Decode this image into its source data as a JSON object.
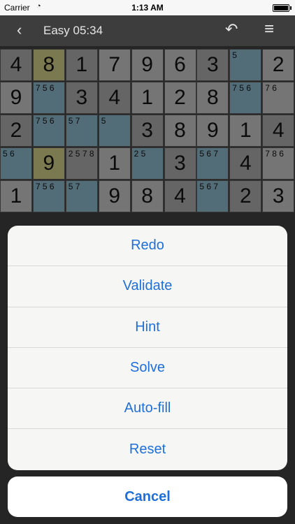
{
  "status_bar": {
    "carrier": "Carrier",
    "time": "1:13 AM"
  },
  "nav": {
    "back_icon": "chevron-left-icon",
    "difficulty": "Easy",
    "timer": "05:34",
    "title": "Easy  05:34"
  },
  "board": {
    "rows": [
      [
        "4",
        "8",
        "1",
        "7",
        "9",
        "6",
        "3",
        "",
        "2"
      ],
      [
        "9",
        "",
        "3",
        "4",
        "1",
        "2",
        "8",
        "",
        ""
      ],
      [
        "2",
        "",
        "",
        "",
        "3",
        "8",
        "9",
        "1",
        "4"
      ],
      [
        "",
        "9",
        "",
        "1",
        "",
        "3",
        "",
        "4",
        ""
      ],
      [
        "1",
        "",
        "",
        "9",
        "8",
        "4",
        "",
        "2",
        "3"
      ]
    ],
    "notes": {
      "r1c8": "5",
      "r2c2": "7 5 6",
      "r2c8": "7 5 6",
      "r2c9": "7 6",
      "r3c2": "7 5 6",
      "r3c3": "5 7",
      "r3c4": "5",
      "r4c1": "5 6",
      "r4c3": "2 5 7 8",
      "r4c5": "2 5",
      "r4c7": "5 6 7",
      "r4c9": "7 8 6",
      "r5c2": "7 5 6",
      "r5c3": "5 7",
      "r5c7": "5 6 7"
    }
  },
  "action_sheet": {
    "items": [
      "Redo",
      "Validate",
      "Hint",
      "Solve",
      "Auto-fill",
      "Reset"
    ],
    "cancel": "Cancel"
  }
}
